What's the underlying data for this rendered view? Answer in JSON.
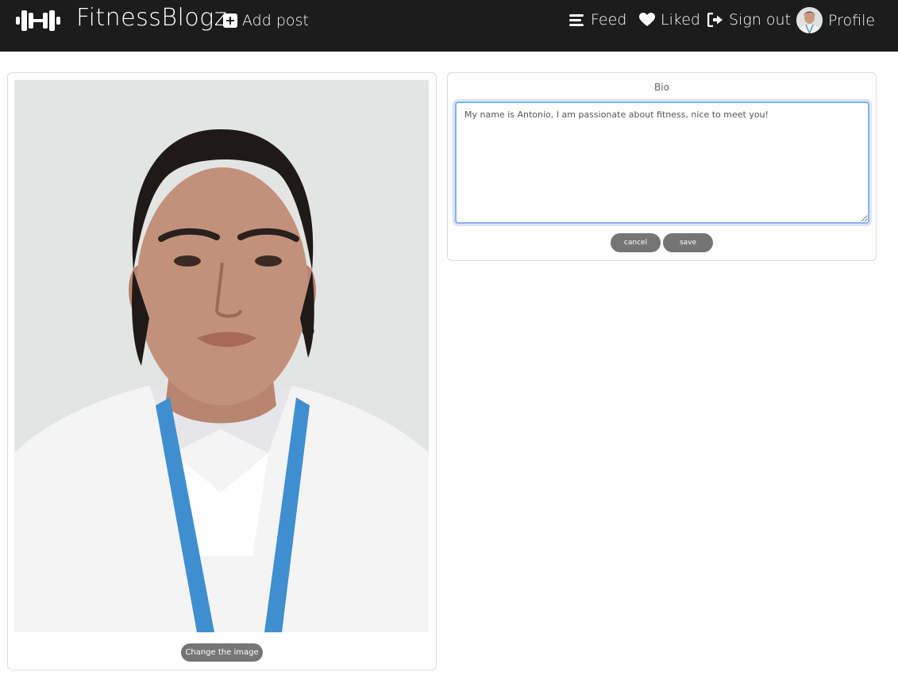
{
  "nav": {
    "brand": "FitnessBlogz",
    "add_post": "Add post",
    "feed": "Feed",
    "liked": "Liked",
    "sign_out": "Sign out",
    "profile": "Profile"
  },
  "icons": {
    "logo": "dumbbell-icon",
    "add_post": "plus-square-icon",
    "feed": "bars-icon",
    "liked": "heart-icon",
    "sign_out": "sign-out-icon",
    "profile": "user-avatar"
  },
  "profile": {
    "change_image_label": "Change the image"
  },
  "bio": {
    "label": "Bio",
    "text": "My name is Antonio, I am passionate about fitness, nice to meet you!",
    "cancel_label": "cancel",
    "save_label": "save"
  },
  "colors": {
    "navbar_bg": "#1c1c1c",
    "button_bg": "#757575",
    "textarea_focus": "#86b2f5"
  }
}
